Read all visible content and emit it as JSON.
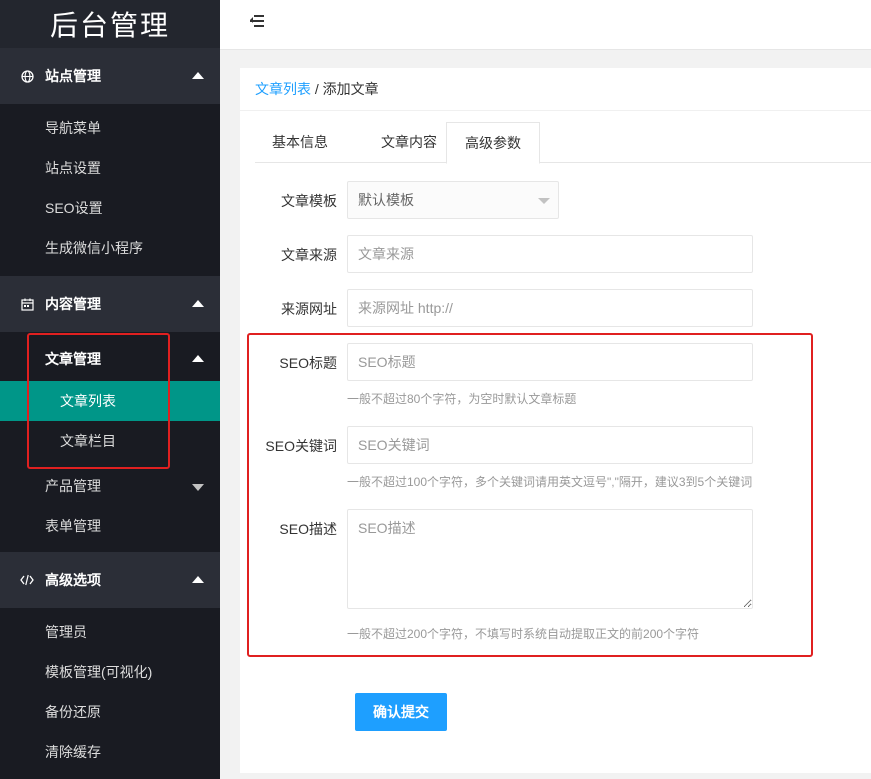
{
  "app": {
    "logo_text": "后台管理"
  },
  "sidebar": {
    "groups": [
      {
        "title": "站点管理",
        "icon": "globe-icon",
        "items": [
          "导航菜单",
          "站点设置",
          "SEO设置",
          "生成微信小程序"
        ]
      },
      {
        "title": "内容管理",
        "icon": "calendar-icon",
        "items": [
          {
            "label": "文章管理",
            "children": [
              "文章列表",
              "文章栏目"
            ]
          },
          {
            "label": "产品管理"
          },
          {
            "label": "表单管理"
          }
        ]
      },
      {
        "title": "高级选项",
        "icon": "code-icon",
        "items": [
          "管理员",
          "模板管理(可视化)",
          "备份还原",
          "清除缓存"
        ]
      }
    ]
  },
  "header": {
    "toggle_icon": "menu-fold-icon"
  },
  "breadcrumb": {
    "parent": "文章列表",
    "separator": " / ",
    "current": "添加文章"
  },
  "tabs": [
    "基本信息",
    "文章内容",
    "高级参数"
  ],
  "active_tab": "高级参数",
  "form": {
    "template": {
      "label": "文章模板",
      "value": "默认模板"
    },
    "source": {
      "label": "文章来源",
      "placeholder": "文章来源"
    },
    "source_url": {
      "label": "来源网址",
      "placeholder": "来源网址 http://"
    },
    "seo_title": {
      "label": "SEO标题",
      "placeholder": "SEO标题",
      "help": "一般不超过80个字符，为空时默认文章标题"
    },
    "seo_keywords": {
      "label": "SEO关键词",
      "placeholder": "SEO关键词",
      "help": "一般不超过100个字符，多个关键词请用英文逗号\",\"隔开，建议3到5个关键词"
    },
    "seo_description": {
      "label": "SEO描述",
      "placeholder": "SEO描述",
      "help": "一般不超过200个字符，不填写时系统自动提取正文的前200个字符"
    },
    "submit_label": "确认提交"
  },
  "colors": {
    "sidebar_bg": "#23262e",
    "active_item": "#009688",
    "link": "#1e9fff",
    "submit": "#1e9fff",
    "highlight_box": "#e02020"
  }
}
